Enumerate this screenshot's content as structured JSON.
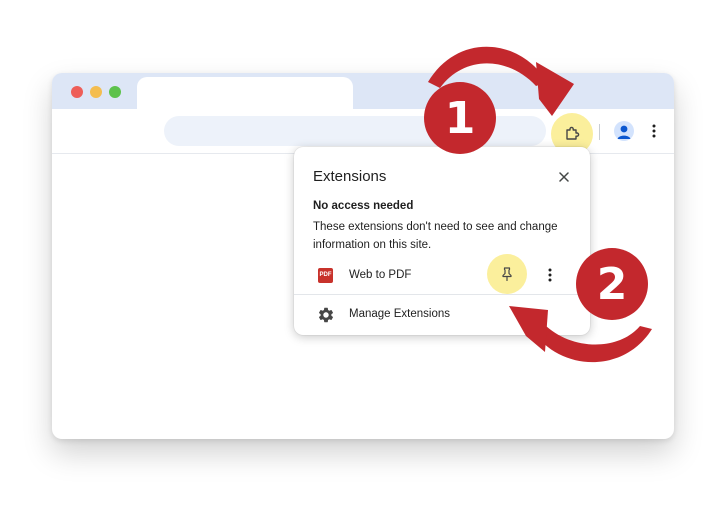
{
  "popup": {
    "title": "Extensions",
    "section_heading": "No access needed",
    "section_description": "These extensions don't need to see and change information on this site.",
    "extension": {
      "name": "Web to PDF",
      "icon_text": "PDF"
    },
    "manage_label": "Manage Extensions"
  },
  "callouts": {
    "step_1": "1",
    "step_2": "2"
  },
  "colors": {
    "callout_red": "#c3282d",
    "highlight_yellow": "#fbef9c",
    "titlebar_blue": "#dde6f6",
    "omnibox_fill": "#edf2fa"
  },
  "icons": {
    "toolbar": [
      "puzzle-icon",
      "profile-icon",
      "more-vert-icon"
    ],
    "popup": [
      "close-icon",
      "pdf-icon",
      "pin-icon",
      "more-vert-icon",
      "gear-icon"
    ]
  }
}
